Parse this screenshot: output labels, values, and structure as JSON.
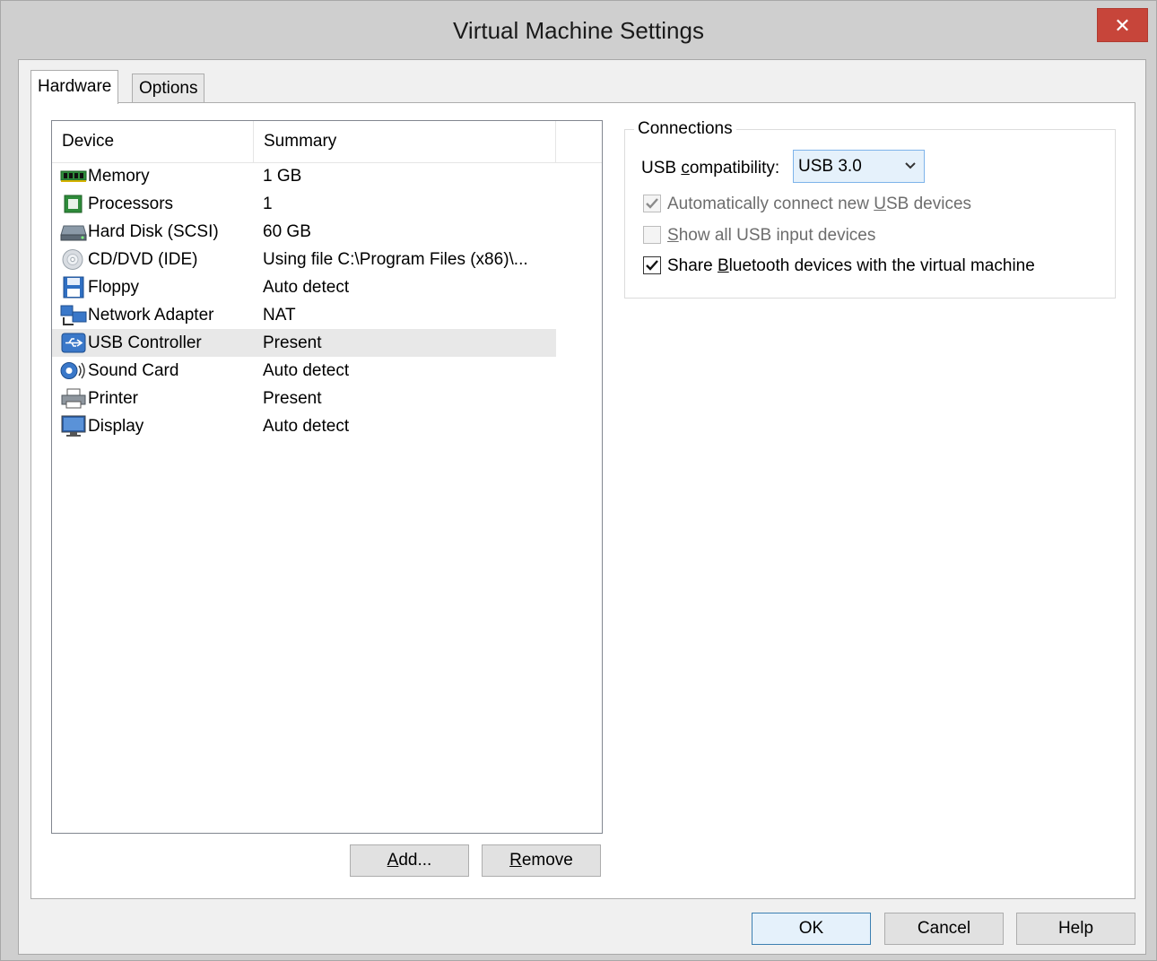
{
  "window": {
    "title": "Virtual Machine Settings",
    "close_glyph": "✕"
  },
  "tabs": [
    {
      "label": "Hardware",
      "active": true
    },
    {
      "label": "Options",
      "active": false
    }
  ],
  "device_list": {
    "columns": [
      "Device",
      "Summary"
    ],
    "rows": [
      {
        "device": "Memory",
        "summary": "1 GB",
        "icon": "memory-icon"
      },
      {
        "device": "Processors",
        "summary": "1",
        "icon": "processor-icon"
      },
      {
        "device": "Hard Disk (SCSI)",
        "summary": "60 GB",
        "icon": "hard-disk-icon"
      },
      {
        "device": "CD/DVD (IDE)",
        "summary": "Using file C:\\Program Files (x86)\\...",
        "icon": "cd-dvd-icon"
      },
      {
        "device": "Floppy",
        "summary": "Auto detect",
        "icon": "floppy-icon"
      },
      {
        "device": "Network Adapter",
        "summary": "NAT",
        "icon": "network-adapter-icon"
      },
      {
        "device": "USB Controller",
        "summary": "Present",
        "icon": "usb-icon",
        "selected": true
      },
      {
        "device": "Sound Card",
        "summary": "Auto detect",
        "icon": "sound-card-icon"
      },
      {
        "device": "Printer",
        "summary": "Present",
        "icon": "printer-icon"
      },
      {
        "device": "Display",
        "summary": "Auto detect",
        "icon": "display-icon"
      }
    ]
  },
  "list_buttons": {
    "add": {
      "pre": "",
      "mnemonic": "A",
      "post": "dd..."
    },
    "remove": {
      "pre": "",
      "mnemonic": "R",
      "post": "emove"
    }
  },
  "connections": {
    "title": "Connections",
    "usb_label": {
      "pre": "USB ",
      "mnemonic": "c",
      "post": "ompatibility:"
    },
    "usb_value": "USB 3.0",
    "options": [
      {
        "pre": "Automatically connect new ",
        "mnemonic": "U",
        "post": "SB devices",
        "checked": true,
        "enabled": false
      },
      {
        "pre": "",
        "mnemonic": "S",
        "post": "how all USB input devices",
        "checked": false,
        "enabled": false
      },
      {
        "pre": "Share ",
        "mnemonic": "B",
        "post": "luetooth devices with the virtual machine",
        "checked": true,
        "enabled": true
      }
    ]
  },
  "dialog_buttons": {
    "ok": "OK",
    "cancel": "Cancel",
    "help": "Help"
  },
  "colors": {
    "title_bar": "#cfcfcf",
    "close_button": "#c7453a",
    "selection": "#e8e8e8",
    "ok_border": "#3c7fb1"
  }
}
